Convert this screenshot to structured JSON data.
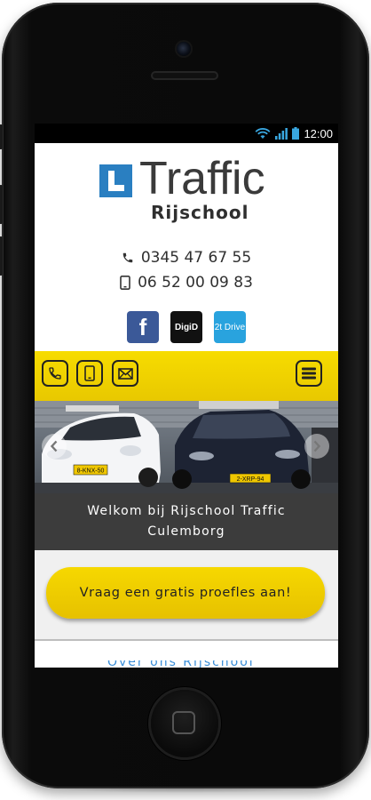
{
  "status_bar": {
    "time": "12:00"
  },
  "brand": {
    "name": "Traffic",
    "subtitle": "Rijschool"
  },
  "contact": {
    "landline": "0345 47 67 55",
    "mobile": "06 52 00 09 83"
  },
  "social": [
    {
      "name": "facebook",
      "label": "f",
      "color": "#3b5998"
    },
    {
      "name": "digid",
      "label": "DigiD",
      "color": "#111111"
    },
    {
      "name": "2todrive",
      "label": "2t Drive",
      "color": "#29a3de"
    }
  ],
  "nav": {
    "icons": [
      "phone-icon",
      "mobile-icon",
      "mail-icon"
    ],
    "menu_icon": "menu-icon",
    "accent": "#f2d400"
  },
  "slider": {
    "caption_line1": "Welkom bij Rijschool Traffic",
    "caption_line2": "Culemborg",
    "plates": [
      "8-KNX-50",
      "2-XRP-94"
    ]
  },
  "cta": {
    "label": "Vraag een gratis proefles aan!"
  },
  "teaser": {
    "text": "Over ons Rijschool"
  }
}
